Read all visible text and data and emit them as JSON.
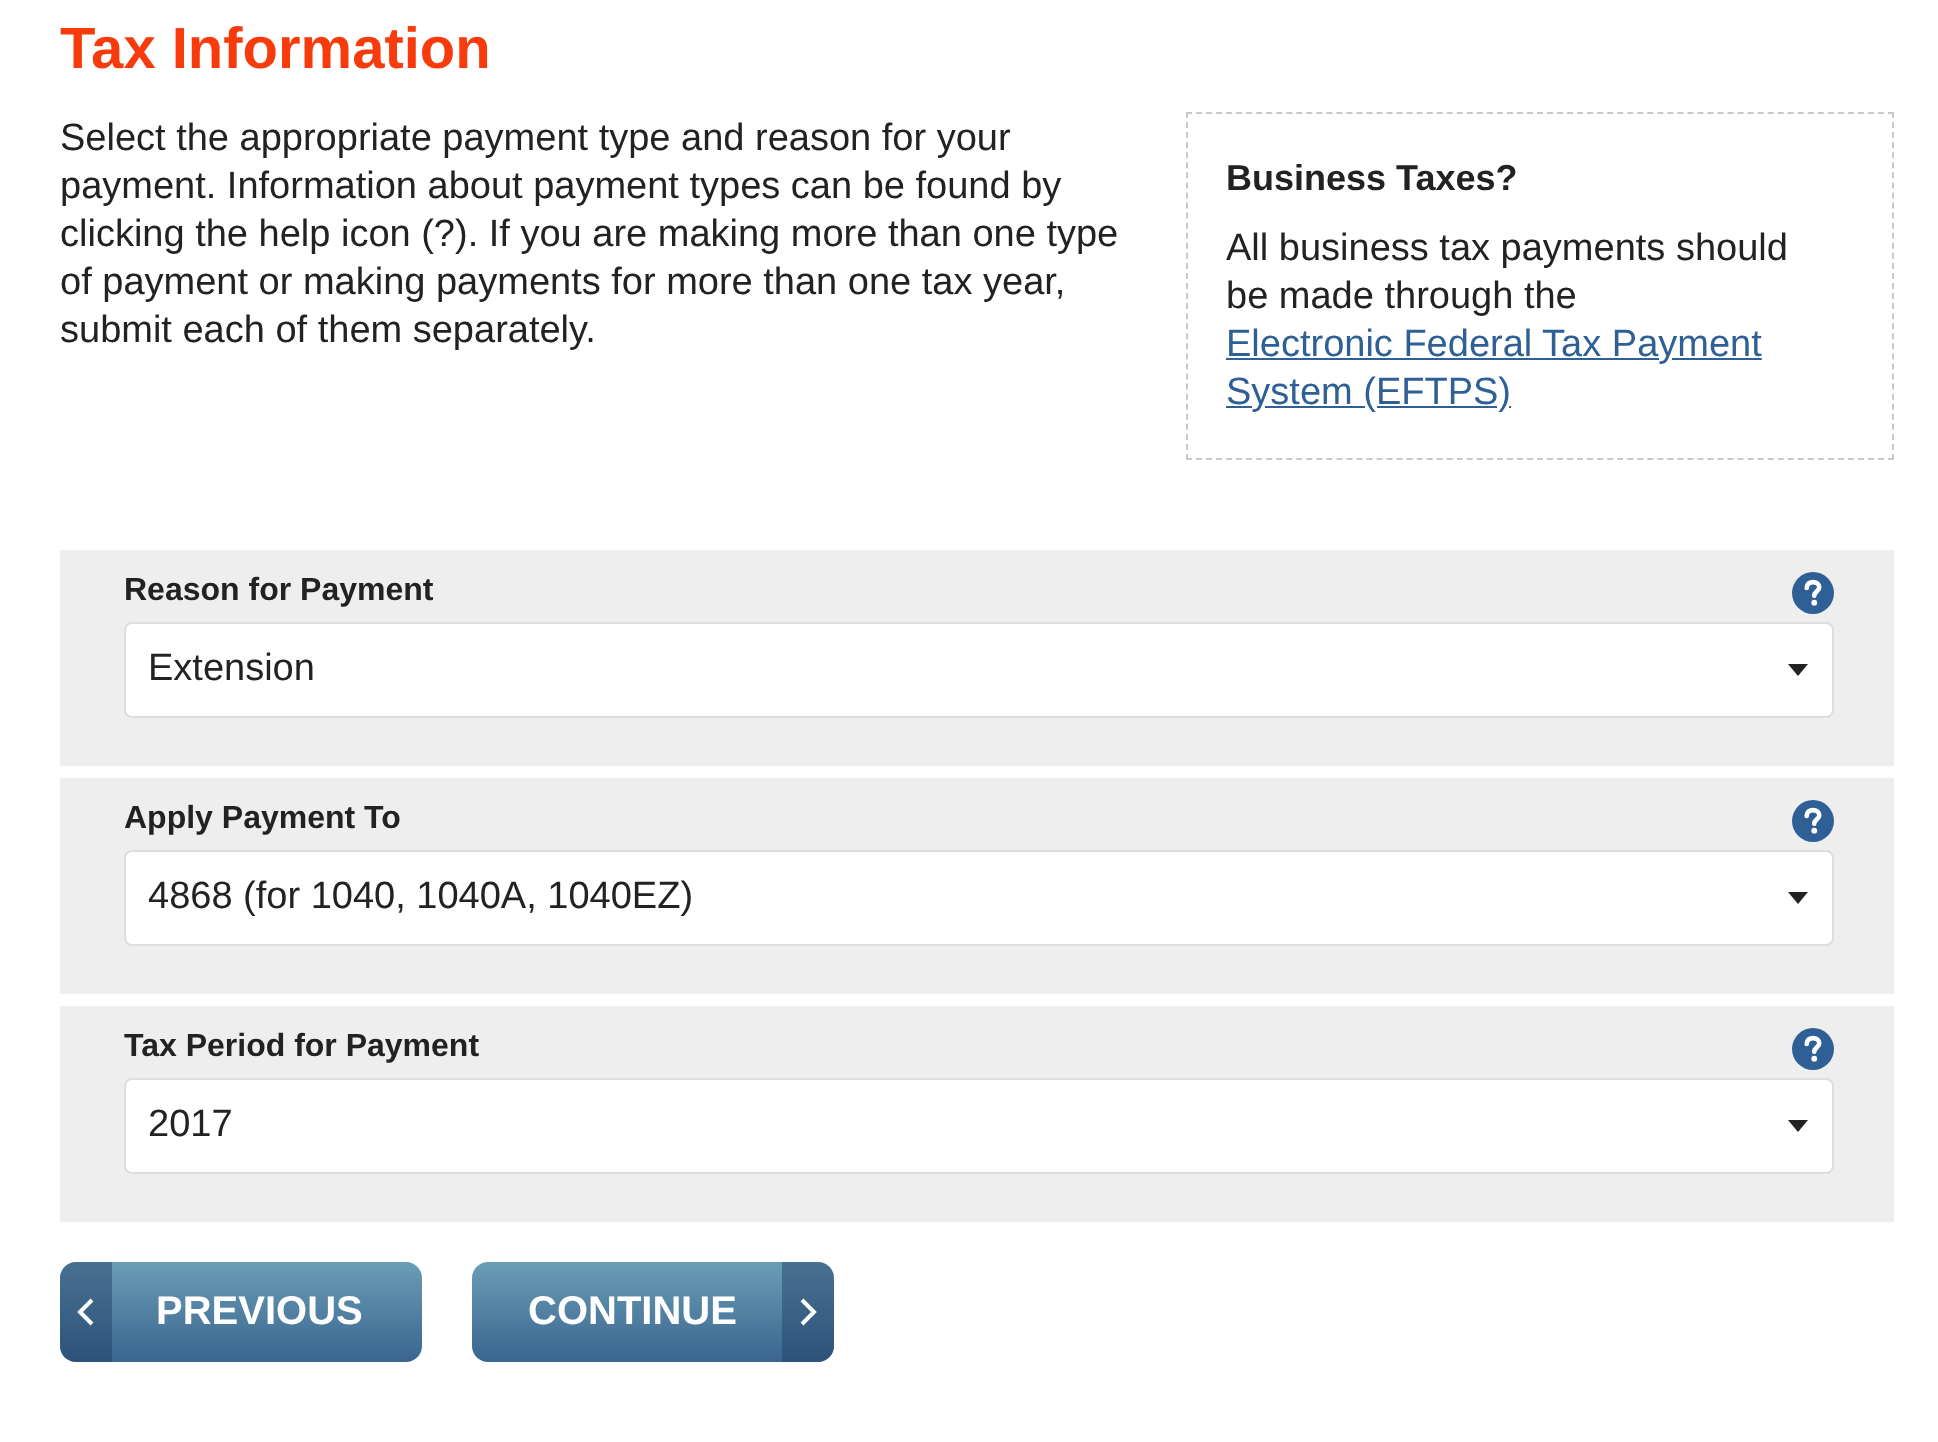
{
  "heading": "Tax Information",
  "intro": "Select the appropriate payment type and reason for your payment. Information about payment types can be found by clicking the help icon (?). If you are making more than one type of payment or making payments for more than one tax year, submit each of them separately.",
  "aside": {
    "title": "Business Taxes?",
    "text": "All business tax payments should be made through the",
    "link": "Electronic Federal Tax Payment System (EFTPS)"
  },
  "fields": [
    {
      "label": "Reason for Payment",
      "value": "Extension"
    },
    {
      "label": "Apply Payment To",
      "value": "4868 (for 1040, 1040A, 1040EZ)"
    },
    {
      "label": "Tax Period for Payment",
      "value": "2017"
    }
  ],
  "buttons": [
    {
      "label": "PREVIOUS",
      "kind": "previous"
    },
    {
      "label": "CONTINUE",
      "kind": "next"
    }
  ]
}
